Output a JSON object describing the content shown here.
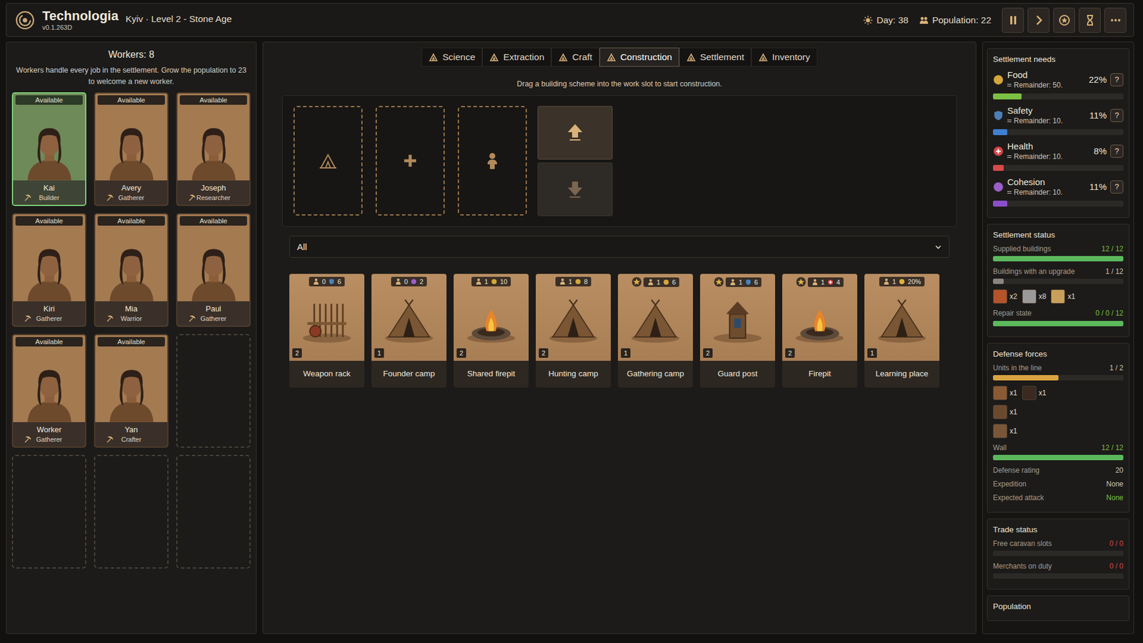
{
  "app": {
    "title": "Technologia",
    "version": "v0.1.263D",
    "location": "Kyiv · Level 2 - Stone Age"
  },
  "header": {
    "day": "Day: 38",
    "population": "Population: 22"
  },
  "workers": {
    "title": "Workers: 8",
    "hint": "Workers handle every job in the settlement. Grow the population to 23 to welcome a new worker.",
    "items": [
      {
        "kind": "worker",
        "name": "Kai",
        "role": "Builder",
        "status": "Available",
        "selected": true
      },
      {
        "kind": "worker",
        "name": "Avery",
        "role": "Gatherer",
        "status": "Available",
        "selected": false
      },
      {
        "kind": "worker",
        "name": "Joseph",
        "role": "Researcher",
        "status": "Available",
        "selected": false
      },
      {
        "kind": "worker",
        "name": "Kiri",
        "role": "Gatherer",
        "status": "Available",
        "selected": false
      },
      {
        "kind": "worker",
        "name": "Mia",
        "role": "Warrior",
        "status": "Available",
        "selected": false
      },
      {
        "kind": "worker",
        "name": "Paul",
        "role": "Gatherer",
        "status": "Available",
        "selected": false
      },
      {
        "kind": "worker",
        "name": "Worker",
        "role": "Gatherer",
        "status": "Available",
        "selected": false
      },
      {
        "kind": "worker",
        "name": "Yan",
        "role": "Crafter",
        "status": "Available",
        "selected": false
      },
      {
        "kind": "empty",
        "selected": false
      },
      {
        "kind": "empty",
        "selected": false
      },
      {
        "kind": "empty",
        "selected": false
      },
      {
        "kind": "empty",
        "selected": false
      }
    ]
  },
  "tabs": [
    {
      "label": "Science",
      "selected": false
    },
    {
      "label": "Extraction",
      "selected": false
    },
    {
      "label": "Craft",
      "selected": false
    },
    {
      "label": "Construction",
      "selected": true
    },
    {
      "label": "Settlement",
      "selected": false
    },
    {
      "label": "Inventory",
      "selected": false
    }
  ],
  "construction": {
    "hint": "Drag a building scheme into the work slot to start construction.",
    "slots": [
      {
        "kind": "building"
      },
      {
        "kind": "add"
      },
      {
        "kind": "worker"
      }
    ],
    "actions": [
      {
        "kind": "up",
        "disabled": false
      },
      {
        "kind": "down",
        "disabled": true
      }
    ],
    "filter": "All",
    "buildings": [
      {
        "name": "Weapon rack",
        "star": false,
        "workers": "0",
        "effect": "6",
        "effect_kind": "safety",
        "count": "2"
      },
      {
        "name": "Founder camp",
        "star": false,
        "workers": "0",
        "effect": "2",
        "effect_kind": "cohesion",
        "count": "1"
      },
      {
        "name": "Shared firepit",
        "star": false,
        "workers": "1",
        "effect": "10",
        "effect_kind": "food",
        "count": "2"
      },
      {
        "name": "Hunting camp",
        "star": false,
        "workers": "1",
        "effect": "8",
        "effect_kind": "food",
        "count": "2"
      },
      {
        "name": "Gathering camp",
        "star": true,
        "workers": "1",
        "effect": "6",
        "effect_kind": "food",
        "count": "1"
      },
      {
        "name": "Guard post",
        "star": true,
        "workers": "1",
        "effect": "6",
        "effect_kind": "safety",
        "count": "2"
      },
      {
        "name": "Firepit",
        "star": true,
        "workers": "1",
        "effect": "4",
        "effect_kind": "health",
        "count": "2"
      },
      {
        "name": "Learning place",
        "star": false,
        "workers": "1",
        "effect": "20%",
        "effect_kind": "research",
        "count": "1"
      }
    ]
  },
  "needs": {
    "title": "Settlement needs",
    "help": "?",
    "items": [
      {
        "name": "Food",
        "kind": "food",
        "percent": "22%",
        "remainder": "Remainder: 50.",
        "level": 0.22,
        "color": "#7bc043"
      },
      {
        "name": "Safety",
        "kind": "safety",
        "percent": "11%",
        "remainder": "Remainder: 10.",
        "level": 0.11,
        "color": "#3f7fcf"
      },
      {
        "name": "Health",
        "kind": "health",
        "percent": "8%",
        "remainder": "Remainder: 10.",
        "level": 0.08,
        "color": "#d84a4a"
      },
      {
        "name": "Cohesion",
        "kind": "cohesion",
        "percent": "11%",
        "remainder": "Remainder: 10.",
        "level": 0.11,
        "color": "#8a4fc8"
      }
    ]
  },
  "panels": [
    {
      "title": "Settlement status",
      "rows": [
        {
          "kind": "bar",
          "label": "Supplied buildings",
          "value": "12 / 12",
          "value_color": "#7bc043",
          "level": 1,
          "color": "#5cb85c"
        },
        {
          "kind": "bar",
          "label": "Buildings with an upgrade",
          "value": "1 / 12",
          "value_color": "#cfc6b8",
          "level": 0.083,
          "color": "#8a8580"
        },
        {
          "kind": "items",
          "items": [
            {
              "count": "x2",
              "color": "#b5532a"
            },
            {
              "count": "x8",
              "color": "#9a9a9a"
            },
            {
              "count": "x1",
              "color": "#c9a05a"
            }
          ]
        },
        {
          "kind": "bar",
          "label": "Repair state",
          "value": "0 / 0 / 12",
          "value_color": "#7bc043",
          "level": 1,
          "color": "#5cb85c"
        }
      ]
    },
    {
      "title": "Defense forces",
      "rows": [
        {
          "kind": "bar",
          "label": "Units in the line",
          "value": "1 / 2",
          "value_color": "#cfc6b8",
          "level": 0.5,
          "color": "#d9a441"
        },
        {
          "kind": "items",
          "items": [
            {
              "count": "x1",
              "color": "#8a5a34"
            },
            {
              "count": "x1",
              "color": "#3a2a20"
            }
          ]
        },
        {
          "kind": "items",
          "items": [
            {
              "count": "x1",
              "color": "#6a4a2e"
            }
          ]
        },
        {
          "kind": "items",
          "items": [
            {
              "count": "x1",
              "color": "#7a5638"
            }
          ]
        },
        {
          "kind": "bar",
          "label": "Wall",
          "value": "12 / 12",
          "value_color": "#7bc043",
          "level": 1,
          "color": "#5cb85c"
        },
        {
          "kind": "stat",
          "label": "Defense rating",
          "value": "20",
          "value_color": "#cfc6b8"
        },
        {
          "kind": "stat",
          "label": "Expedition",
          "value": "None",
          "value_color": "#cfc6b8"
        },
        {
          "kind": "stat",
          "label": "Expected attack",
          "value": "None",
          "value_color": "#7bc043"
        }
      ]
    },
    {
      "title": "Trade status",
      "rows": [
        {
          "kind": "bar",
          "label": "Free caravan slots",
          "value": "0 / 0",
          "value_color": "#d84a4a",
          "level": 0,
          "color": "#5cb85c"
        },
        {
          "kind": "bar",
          "label": "Merchants on duty",
          "value": "0 / 0",
          "value_color": "#d84a4a",
          "level": 0,
          "color": "#5cb85c"
        }
      ]
    },
    {
      "title": "Population",
      "rows": []
    }
  ]
}
